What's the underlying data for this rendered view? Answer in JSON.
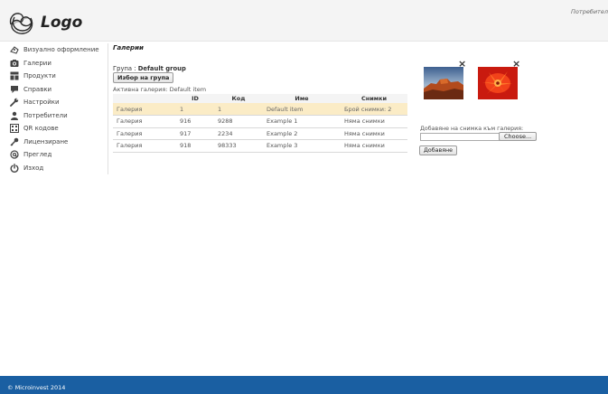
{
  "header": {
    "logo_text": "Logo",
    "user_label": "Потребител"
  },
  "sidebar": {
    "items": [
      {
        "label": "Визуално оформление",
        "icon": "appearance-icon"
      },
      {
        "label": "Галерии",
        "icon": "camera-icon"
      },
      {
        "label": "Продукти",
        "icon": "products-icon"
      },
      {
        "label": "Справки",
        "icon": "comment-icon"
      },
      {
        "label": "Настройки",
        "icon": "wrench-icon"
      },
      {
        "label": "Потребители",
        "icon": "user-icon"
      },
      {
        "label": "QR кодове",
        "icon": "qr-code-icon"
      },
      {
        "label": "Лицензиране",
        "icon": "key-icon"
      },
      {
        "label": "Преглед",
        "icon": "at-icon"
      },
      {
        "label": "Изход",
        "icon": "power-icon"
      }
    ]
  },
  "main": {
    "title": "Галерии",
    "group_label": "Група :",
    "group_value": "Default group",
    "choose_group_button": "Избор на група",
    "active_gallery": "Активна галерия: Default item",
    "table": {
      "headers": [
        "",
        "ID",
        "Код",
        "Име",
        "Снимки"
      ],
      "rows": [
        {
          "type": "Галерия",
          "id": "1",
          "code": "1",
          "name": "Default item",
          "photos": "Брой снимки: 2",
          "active": true
        },
        {
          "type": "Галерия",
          "id": "916",
          "code": "9288",
          "name": "Example 1",
          "photos": "Няма снимки",
          "active": false
        },
        {
          "type": "Галерия",
          "id": "917",
          "code": "2234",
          "name": "Example 2",
          "photos": "Няма снимки",
          "active": false
        },
        {
          "type": "Галерия",
          "id": "918",
          "code": "98333",
          "name": "Example 3",
          "photos": "Няма снимки",
          "active": false
        }
      ]
    }
  },
  "photos_panel": {
    "delete_symbol": "×",
    "add_label": "Добавяне на снимка към галерия:",
    "file_button": "Choose...",
    "add_button": "Добавяне"
  },
  "footer": {
    "text": "© Microinvest 2014"
  },
  "colors": {
    "footer_bg": "#1a5fa2",
    "active_row_bg": "#fbecc6",
    "header_bg": "#f4f4f4"
  }
}
